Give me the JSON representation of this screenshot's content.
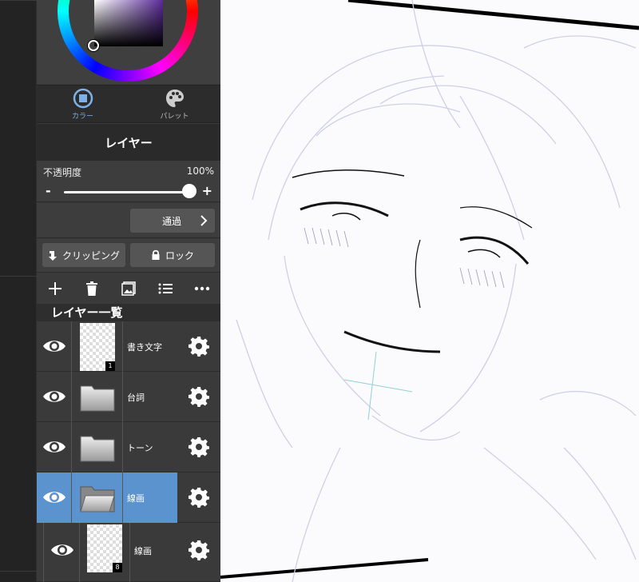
{
  "color_panel": {
    "tabs": [
      {
        "label": "カラー",
        "icon": "color-square-icon",
        "active": true
      },
      {
        "label": "パレット",
        "icon": "palette-icon",
        "active": false
      }
    ],
    "accent": "#7fb0e8"
  },
  "layer_panel": {
    "title": "レイヤー",
    "opacity_label": "不透明度",
    "opacity_value": "100%",
    "opacity_level": 1.0,
    "minus": "-",
    "plus": "+",
    "blend_mode": "通過",
    "clipping_label": "クリッピング",
    "lock_label": "ロック",
    "toolbar": [
      "plus-icon",
      "trash-icon",
      "image-icon",
      "list-icon",
      "more-icon"
    ],
    "list_title": "レイヤー一覧",
    "layers": [
      {
        "name": "書き文字",
        "type": "raster",
        "badge": "1",
        "visible": true,
        "selected": false
      },
      {
        "name": "台詞",
        "type": "folder",
        "visible": true,
        "selected": false
      },
      {
        "name": "トーン",
        "type": "folder",
        "visible": true,
        "selected": false
      },
      {
        "name": "線画",
        "type": "folder-open",
        "visible": true,
        "selected": true
      },
      {
        "name": "線画",
        "type": "raster",
        "badge": "8",
        "visible": true,
        "selected": false,
        "indent": true
      }
    ],
    "selection_color": "#5b93cf"
  }
}
